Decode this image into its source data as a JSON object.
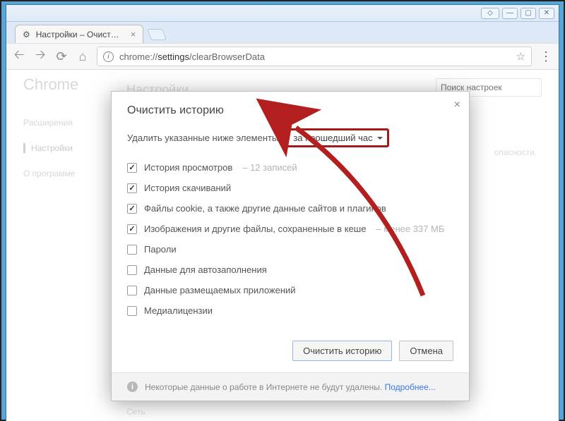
{
  "window": {
    "tab_title": "Настройки – Очистить и",
    "url_prefix": "chrome://",
    "url_segment": "settings",
    "url_suffix": "/clearBrowserData"
  },
  "sidebar": {
    "brand": "Chrome",
    "items": [
      "Расширения",
      "Настройки",
      "О программе"
    ]
  },
  "page": {
    "section_title": "Настройки",
    "search_placeholder": "Поиск настроек",
    "right_text": "опасности",
    "footer_text": "Сеть"
  },
  "dialog": {
    "title": "Очистить историю",
    "prompt": "Удалить указанные ниже элементы",
    "time_range": "за прошедший час",
    "options": [
      {
        "label": "История просмотров",
        "hint": "– 12 записей",
        "checked": true
      },
      {
        "label": "История скачиваний",
        "hint": "",
        "checked": true
      },
      {
        "label": "Файлы cookie, а также другие данные сайтов и плагинов",
        "hint": "",
        "checked": true
      },
      {
        "label": "Изображения и другие файлы, сохраненные в кеше",
        "hint": "– менее 337 МБ",
        "checked": true
      },
      {
        "label": "Пароли",
        "hint": "",
        "checked": false
      },
      {
        "label": "Данные для автозаполнения",
        "hint": "",
        "checked": false
      },
      {
        "label": "Данные размещаемых приложений",
        "hint": "",
        "checked": false
      },
      {
        "label": "Медиалицензии",
        "hint": "",
        "checked": false
      }
    ],
    "clear_btn": "Очистить историю",
    "cancel_btn": "Отмена",
    "footer_text": "Некоторые данные о работе в Интернете не будут удалены.",
    "footer_link": "Подробнее..."
  },
  "annotation": {
    "arrow_color": "#b21f1e"
  }
}
